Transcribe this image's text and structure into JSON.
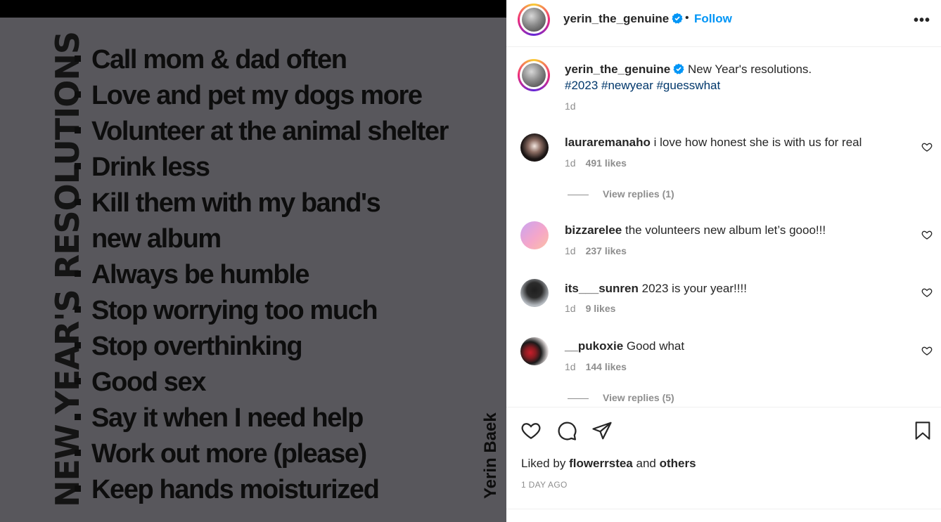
{
  "poster": {
    "vertical_title": "NEW YEAR'S RESOLUTIONS",
    "items": [
      "Call mom & dad often",
      "Love and pet my dogs more",
      "Volunteer at the animal shelter",
      "Drink less",
      "Kill them with my band's",
      "Always be humble",
      "Stop worrying too much",
      "Stop overthinking",
      "Good sex",
      "Say it when I need help",
      "Work out more (please)",
      "Keep hands moisturized"
    ],
    "item_continuation": "new album",
    "author": "Yerin Baek"
  },
  "header": {
    "username": "yerin_the_genuine",
    "separator": "•",
    "follow_label": "Follow",
    "more_label": "•••"
  },
  "caption": {
    "username": "yerin_the_genuine",
    "text": "New Year's resolutions.",
    "hashtags": [
      "#2023",
      "#newyear",
      "#guesswhat"
    ],
    "time": "1d"
  },
  "comments": [
    {
      "username": "lauraremanaho",
      "text": "i love how honest she is with us for real",
      "time": "1d",
      "likes": "491 likes",
      "replies": "View replies (1)"
    },
    {
      "username": "bizzarelee",
      "text": "the volunteers new album let’s gooo!!!",
      "time": "1d",
      "likes": "237 likes"
    },
    {
      "username": "its___sunren",
      "text": "2023 is your year!!!!",
      "time": "1d",
      "likes": "9 likes"
    },
    {
      "username": "__pukoxie",
      "text": "Good what",
      "time": "1d",
      "likes": "144 likes",
      "replies": "View replies (5)"
    }
  ],
  "footer": {
    "liked_prefix": "Liked by",
    "liked_user": "flowerrstea",
    "liked_and": "and",
    "liked_others": "others",
    "date": "1 DAY AGO"
  },
  "colors": {
    "accent": "#0095f6",
    "verified": "#0095f6",
    "poster_bg": "#58575c"
  }
}
